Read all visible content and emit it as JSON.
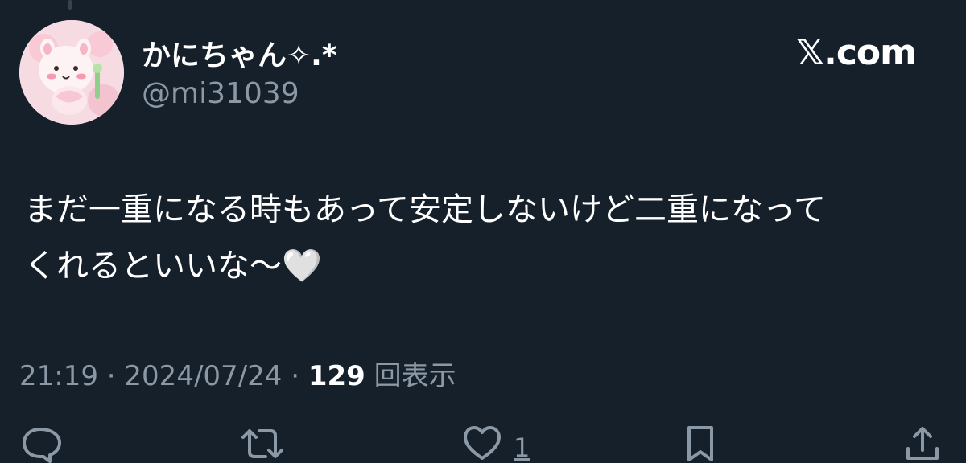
{
  "author": {
    "display_name": "かにちゃん✧.*",
    "handle": "@mi31039"
  },
  "brand": {
    "label": "𝕏.com"
  },
  "tweet": {
    "text": "まだ一重になる時もあって安定しないけど二重になって\nくれるといいな〜🤍"
  },
  "meta": {
    "time": "21:19",
    "separator1": " · ",
    "date": "2024/07/24",
    "separator2": " · ",
    "views_count": "129",
    "views_label": "回表示"
  },
  "actions": {
    "like_count": "1"
  },
  "icons": {
    "reply": "reply-icon",
    "retweet": "retweet-icon",
    "like": "heart-icon",
    "bookmark": "bookmark-icon",
    "share": "share-icon"
  },
  "colors": {
    "background": "#15202b",
    "secondary_text": "#8b98a5",
    "primary_text": "#ffffff"
  }
}
